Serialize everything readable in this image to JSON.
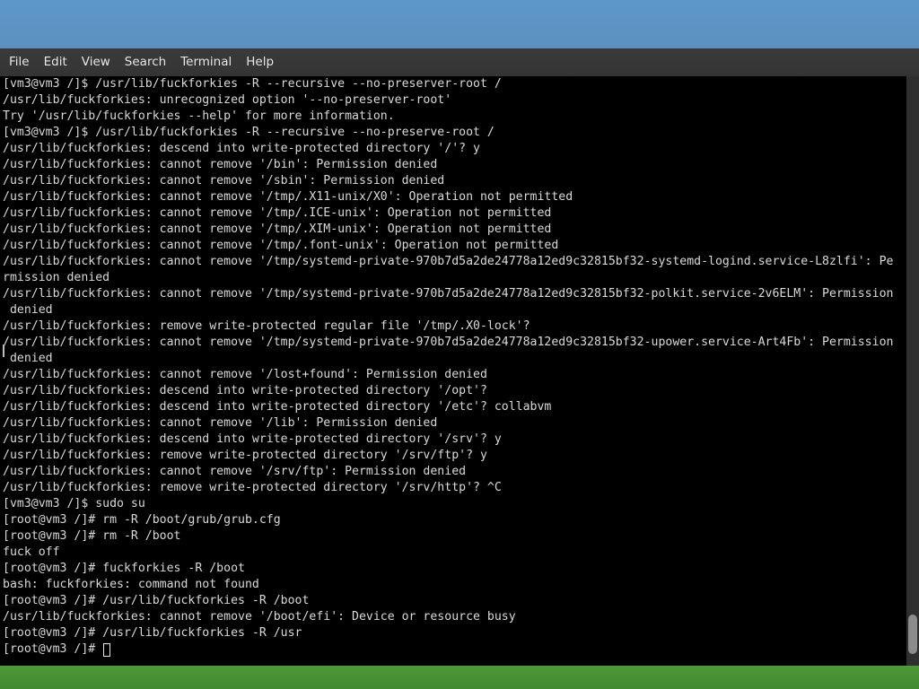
{
  "menu": {
    "items": [
      {
        "label": "File"
      },
      {
        "label": "Edit"
      },
      {
        "label": "View"
      },
      {
        "label": "Search"
      },
      {
        "label": "Terminal"
      },
      {
        "label": "Help"
      }
    ]
  },
  "terminal": {
    "lines": [
      "[vm3@vm3 /]$ /usr/lib/fuckforkies -R --recursive --no-preserver-root /",
      "/usr/lib/fuckforkies: unrecognized option '--no-preserver-root'",
      "Try '/usr/lib/fuckforkies --help' for more information.",
      "[vm3@vm3 /]$ /usr/lib/fuckforkies -R --recursive --no-preserve-root /",
      "/usr/lib/fuckforkies: descend into write-protected directory '/'? y",
      "/usr/lib/fuckforkies: cannot remove '/bin': Permission denied",
      "/usr/lib/fuckforkies: cannot remove '/sbin': Permission denied",
      "/usr/lib/fuckforkies: cannot remove '/tmp/.X11-unix/X0': Operation not permitted",
      "/usr/lib/fuckforkies: cannot remove '/tmp/.ICE-unix': Operation not permitted",
      "/usr/lib/fuckforkies: cannot remove '/tmp/.XIM-unix': Operation not permitted",
      "/usr/lib/fuckforkies: cannot remove '/tmp/.font-unix': Operation not permitted",
      "/usr/lib/fuckforkies: cannot remove '/tmp/systemd-private-970b7d5a2de24778a12ed9c32815bf32-systemd-logind.service-L8zlfi': Pe",
      "rmission denied",
      "/usr/lib/fuckforkies: cannot remove '/tmp/systemd-private-970b7d5a2de24778a12ed9c32815bf32-polkit.service-2v6ELM': Permission",
      " denied",
      "/usr/lib/fuckforkies: remove write-protected regular file '/tmp/.X0-lock'?",
      "/usr/lib/fuckforkies: cannot remove '/tmp/systemd-private-970b7d5a2de24778a12ed9c32815bf32-upower.service-Art4Fb': Permission",
      " denied",
      "/usr/lib/fuckforkies: cannot remove '/lost+found': Permission denied",
      "/usr/lib/fuckforkies: descend into write-protected directory '/opt'?",
      "/usr/lib/fuckforkies: descend into write-protected directory '/etc'? collabvm",
      "/usr/lib/fuckforkies: cannot remove '/lib': Permission denied",
      "/usr/lib/fuckforkies: descend into write-protected directory '/srv'? y",
      "/usr/lib/fuckforkies: remove write-protected directory '/srv/ftp'? y",
      "/usr/lib/fuckforkies: cannot remove '/srv/ftp': Permission denied",
      "/usr/lib/fuckforkies: remove write-protected directory '/srv/http'? ^C",
      "[vm3@vm3 /]$ sudo su",
      "[root@vm3 /]# rm -R /boot/grub/grub.cfg",
      "[root@vm3 /]# rm -R /boot",
      "fuck off",
      "[root@vm3 /]# fuckforkies -R /boot",
      "bash: fuckforkies: command not found",
      "[root@vm3 /]# /usr/lib/fuckforkies -R /boot",
      "/usr/lib/fuckforkies: cannot remove '/boot/efi': Device or resource busy",
      "[root@vm3 /]# /usr/lib/fuckforkies -R /usr"
    ],
    "prompt": "[root@vm3 /]# "
  },
  "colors": {
    "desktop": "#5a93c4",
    "menubar": "#383838",
    "terminal_bg": "#000000",
    "terminal_fg": "#d9d9d9",
    "taskbar": "#4a9636"
  }
}
